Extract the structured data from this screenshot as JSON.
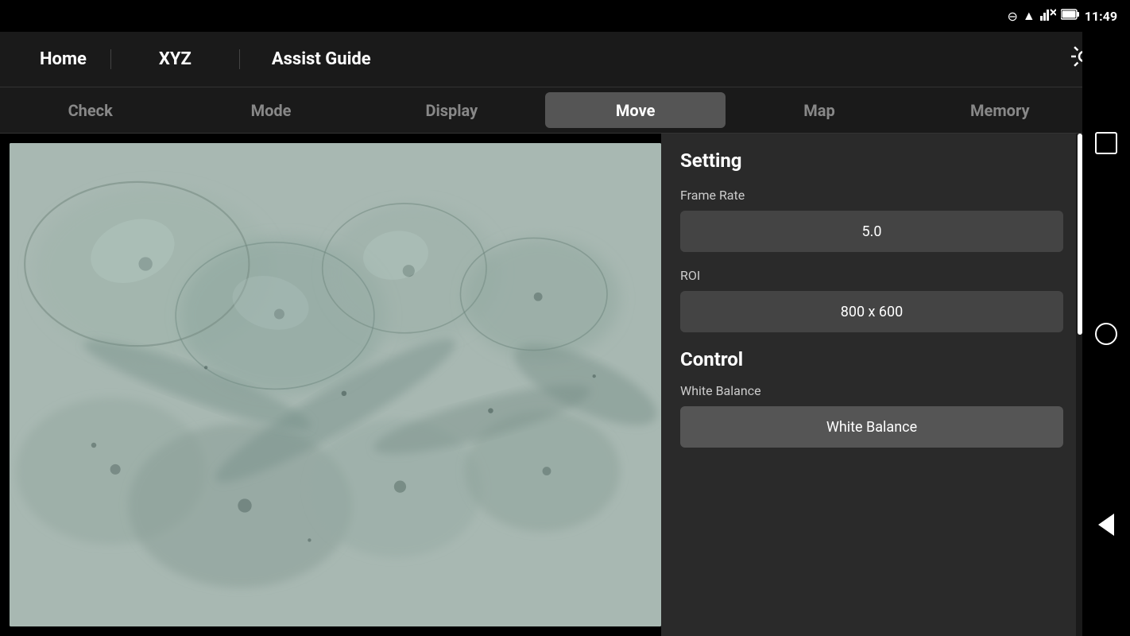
{
  "statusBar": {
    "time": "11:49",
    "icons": [
      "minus-circle",
      "wifi",
      "signal-x",
      "battery"
    ]
  },
  "topNav": {
    "homeLabel": "Home",
    "xyzLabel": "XYZ",
    "assistLabel": "Assist Guide",
    "gearIcon": "⚙"
  },
  "tabs": [
    {
      "id": "check",
      "label": "Check",
      "active": false
    },
    {
      "id": "mode",
      "label": "Mode",
      "active": false
    },
    {
      "id": "display",
      "label": "Display",
      "active": false
    },
    {
      "id": "move",
      "label": "Move",
      "active": true
    },
    {
      "id": "map",
      "label": "Map",
      "active": false
    },
    {
      "id": "memory",
      "label": "Memory",
      "active": false
    }
  ],
  "rightPanel": {
    "settingTitle": "Setting",
    "frameRateLabel": "Frame Rate",
    "frameRateValue": "5.0",
    "roiLabel": "ROI",
    "roiValue": "800 x 600",
    "controlTitle": "Control",
    "whiteBalanceLabel": "White Balance",
    "whiteBalanceButton": "White Balance"
  }
}
